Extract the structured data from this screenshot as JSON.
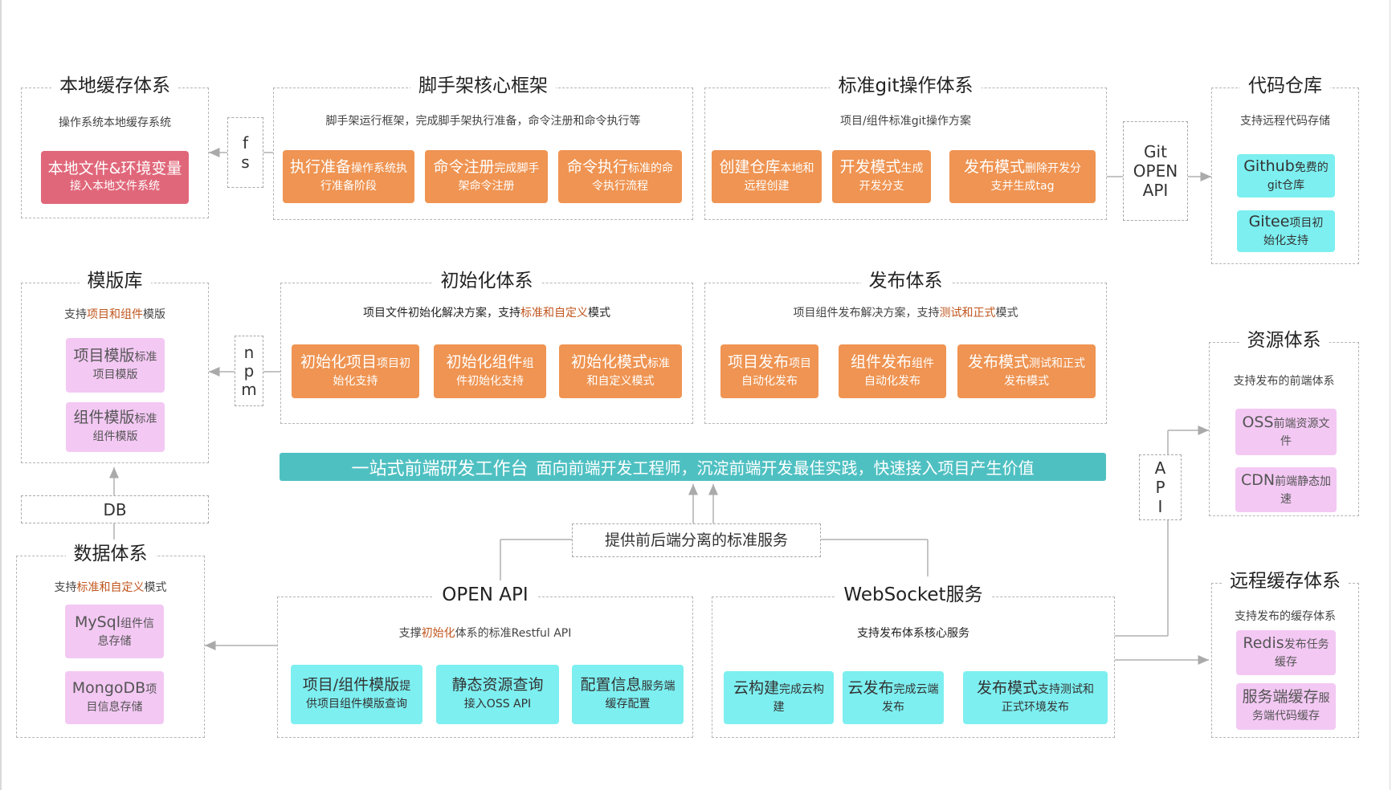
{
  "local_cache": {
    "title": "本地缓存体系",
    "subtitle": "操作系统本地缓存系统",
    "box": {
      "big": "本地文件&环境变量",
      "small": "接入本地文件系统"
    }
  },
  "fs_label": [
    "f",
    "s"
  ],
  "scaffold": {
    "title": "脚手架核心框架",
    "subtitle": "脚手架运行框架，完成脚手架执行准备，命令注册和命令执行等",
    "boxes": [
      {
        "big": "执行准备",
        "small1": "操作系统执",
        "small2": "行准备阶段"
      },
      {
        "big": "命令注册",
        "small1": "完成脚手",
        "small2": "架命令注册"
      },
      {
        "big": "命令执行",
        "small1": "标准的命",
        "small2": "令执行流程"
      }
    ]
  },
  "git": {
    "title": "标准git操作体系",
    "subtitle": "项目/组件标准git操作方案",
    "boxes": [
      {
        "big": "创建仓库",
        "small1": "本地和",
        "small2": "远程创建"
      },
      {
        "big": "开发模式",
        "small1": "生成",
        "small2": "开发分支"
      },
      {
        "big": "发布模式",
        "small1": "删除开发分",
        "small2": "支并生成tag"
      }
    ]
  },
  "git_open_api": [
    "Git",
    "OPEN",
    "API"
  ],
  "repo": {
    "title": "代码仓库",
    "subtitle": "支持远程代码存储",
    "boxes": [
      {
        "big": "Github",
        "small1": "免费的",
        "small2": "git仓库"
      },
      {
        "big": "Gitee",
        "small1": "项目初",
        "small2": "始化支持"
      }
    ]
  },
  "template": {
    "title": "模版库",
    "subtitle_a": "支持",
    "subtitle_b": "项目和组件",
    "subtitle_c": "模版",
    "boxes": [
      {
        "big": "项目模版",
        "small1": "标准",
        "small2": "项目模版"
      },
      {
        "big": "组件模版",
        "small1": "标准",
        "small2": "组件模版"
      }
    ]
  },
  "npm_label": [
    "n",
    "p",
    "m"
  ],
  "init": {
    "title": "初始化体系",
    "subtitle_a": "项目文件初始化解决方案，支持",
    "subtitle_b": "标准和自定义",
    "subtitle_c": "模式",
    "boxes": [
      {
        "big": "初始化项目",
        "small1": "项目初",
        "small2": "始化支持"
      },
      {
        "big": "初始化组件",
        "small1": "组",
        "small2": "件初始化支持"
      },
      {
        "big": "初始化模式",
        "small1": "标准",
        "small2": "和自定义模式"
      }
    ]
  },
  "publish": {
    "title": "发布体系",
    "subtitle_a": "项目组件发布解决方案，支持",
    "subtitle_b": "测试和正式",
    "subtitle_c": "模式",
    "boxes": [
      {
        "big": "项目发布",
        "small1": "项目",
        "small2": "自动化发布"
      },
      {
        "big": "组件发布",
        "small1": "组件",
        "small2": "自动化发布"
      },
      {
        "big": "发布模式",
        "small1": "测试和正式",
        "small2": "发布模式"
      }
    ]
  },
  "resource": {
    "title": "资源体系",
    "subtitle": "支持发布的前端体系",
    "boxes": [
      {
        "big": "OSS",
        "small1": "前端资源文",
        "small2": "件"
      },
      {
        "big": "CDN",
        "small1": "前端静态加",
        "small2": "速"
      }
    ]
  },
  "api_label": [
    "A",
    "P",
    "I"
  ],
  "banner": {
    "main": "一站式前端研发工作台",
    "sub": "面向前端开发工程师，沉淀前端开发最佳实践，快速接入项目产生价值"
  },
  "db_label": "DB",
  "data": {
    "title": "数据体系",
    "subtitle_a": "支持",
    "subtitle_b": "标准和自定义",
    "subtitle_c": "模式",
    "boxes": [
      {
        "big": "MySql",
        "small1": "组件信",
        "small2": "息存储"
      },
      {
        "big": "MongoDB",
        "small1": "项",
        "small2": "目信息存储"
      }
    ]
  },
  "service_label": "提供前后端分离的标准服务",
  "openapi": {
    "title": "OPEN API",
    "subtitle_a": "支撑",
    "subtitle_b": "初始化",
    "subtitle_c": "体系的标准Restful API",
    "boxes": [
      {
        "big": "项目/组件模版",
        "small1": "提",
        "small2": "供项目组件模版查询"
      },
      {
        "big": "静态资源查询",
        "small1": "",
        "small2": "接入OSS API"
      },
      {
        "big": "配置信息",
        "small1": "服务端",
        "small2": "缓存配置"
      }
    ]
  },
  "websocket": {
    "title": "WebSocket服务",
    "subtitle": "支持发布体系核心服务",
    "boxes": [
      {
        "big": "云构建",
        "small1": "完成云构",
        "small2": "建"
      },
      {
        "big": "云发布",
        "small1": "完成云端",
        "small2": "发布"
      },
      {
        "big": "发布模式",
        "small1": "支持测试和",
        "small2": "正式环境发布"
      }
    ]
  },
  "remote_cache": {
    "title": "远程缓存体系",
    "subtitle": "支持发布的缓存体系",
    "boxes": [
      {
        "big": "Redis",
        "small1": "发布任务",
        "small2": "缓存"
      },
      {
        "big": "服务端缓存",
        "small1": "服",
        "small2": "务端代码缓存"
      }
    ]
  },
  "colors": {
    "orange": "#ef9452",
    "red": "#e0677a",
    "pink": "#f3c8f3",
    "cyan": "#7deff0",
    "banner": "#4fc0c2",
    "highlight": "#c0561e"
  }
}
